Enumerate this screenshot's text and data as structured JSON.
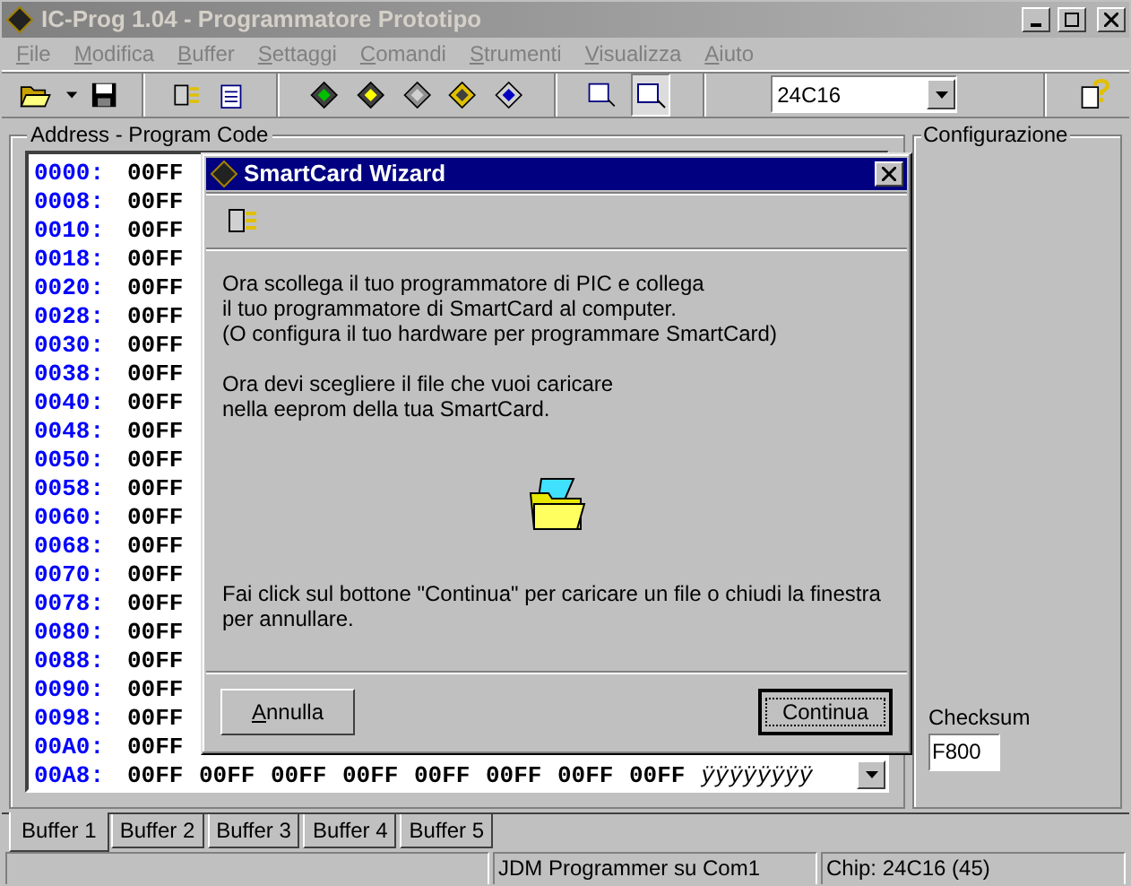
{
  "window": {
    "title": "IC-Prog 1.04 - Programmatore Prototipo"
  },
  "menu": [
    {
      "label": "File"
    },
    {
      "label": "Modifica"
    },
    {
      "label": "Buffer"
    },
    {
      "label": "Settaggi"
    },
    {
      "label": "Comandi"
    },
    {
      "label": "Strumenti"
    },
    {
      "label": "Visualizza"
    },
    {
      "label": "Aiuto"
    }
  ],
  "toolbar": {
    "device": "24C16"
  },
  "program_code": {
    "title": "Address - Program Code",
    "rows": [
      {
        "address": "0000:",
        "values": [
          "00FF"
        ]
      },
      {
        "address": "0008:",
        "values": [
          "00FF"
        ]
      },
      {
        "address": "0010:",
        "values": [
          "00FF"
        ]
      },
      {
        "address": "0018:",
        "values": [
          "00FF"
        ]
      },
      {
        "address": "0020:",
        "values": [
          "00FF"
        ]
      },
      {
        "address": "0028:",
        "values": [
          "00FF"
        ]
      },
      {
        "address": "0030:",
        "values": [
          "00FF"
        ]
      },
      {
        "address": "0038:",
        "values": [
          "00FF"
        ]
      },
      {
        "address": "0040:",
        "values": [
          "00FF"
        ]
      },
      {
        "address": "0048:",
        "values": [
          "00FF"
        ]
      },
      {
        "address": "0050:",
        "values": [
          "00FF"
        ]
      },
      {
        "address": "0058:",
        "values": [
          "00FF"
        ]
      },
      {
        "address": "0060:",
        "values": [
          "00FF"
        ]
      },
      {
        "address": "0068:",
        "values": [
          "00FF"
        ]
      },
      {
        "address": "0070:",
        "values": [
          "00FF"
        ]
      },
      {
        "address": "0078:",
        "values": [
          "00FF"
        ]
      },
      {
        "address": "0080:",
        "values": [
          "00FF"
        ]
      },
      {
        "address": "0088:",
        "values": [
          "00FF"
        ]
      },
      {
        "address": "0090:",
        "values": [
          "00FF"
        ]
      },
      {
        "address": "0098:",
        "values": [
          "00FF"
        ]
      },
      {
        "address": "00A0:",
        "values": [
          "00FF"
        ]
      },
      {
        "address": "00A8:",
        "values": [
          "00FF",
          "00FF",
          "00FF",
          "00FF",
          "00FF",
          "00FF",
          "00FF",
          "00FF"
        ],
        "ascii": "ÿÿÿÿÿÿÿÿ"
      }
    ]
  },
  "configuration": {
    "title": "Configurazione",
    "checksum_label": "Checksum",
    "checksum": "F800"
  },
  "tabs": [
    {
      "label": "Buffer 1",
      "selected": true
    },
    {
      "label": "Buffer 2",
      "selected": false
    },
    {
      "label": "Buffer 3",
      "selected": false
    },
    {
      "label": "Buffer 4",
      "selected": false
    },
    {
      "label": "Buffer 5",
      "selected": false
    }
  ],
  "status_bar": [
    "JDM Programmer su Com1",
    "Chip: 24C16  (45)"
  ],
  "dialog": {
    "title": "SmartCard Wizard",
    "paragraphs": [
      [
        "Ora scollega il tuo programmatore di PIC e collega",
        "il tuo programmatore di SmartCard al computer.",
        "(O configura il tuo hardware per programmare SmartCard)"
      ],
      [
        "Ora devi scegliere il file che vuoi caricare",
        "nella eeprom della tua SmartCard."
      ]
    ],
    "instruction": [
      "Fai click sul bottone \"Continua\" per caricare un file o chiudi la finestra",
      "per annullare."
    ],
    "buttons": [
      {
        "label": "Annulla",
        "default": false
      },
      {
        "label": "Continua",
        "default": true
      }
    ]
  }
}
